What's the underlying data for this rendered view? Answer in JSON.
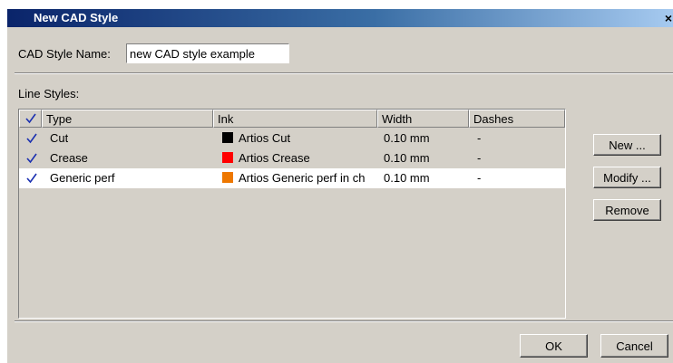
{
  "dialog": {
    "title": "New CAD Style",
    "close_glyph": "×"
  },
  "cad_style_name": {
    "label": "CAD Style Name:",
    "value": "new CAD style example"
  },
  "line_styles": {
    "label": "Line Styles:",
    "columns": [
      "Type",
      "Ink",
      "Width",
      "Dashes"
    ],
    "header_check_icon": "checkmark-icon",
    "rows": [
      {
        "checked": true,
        "type": "Cut",
        "ink": "Artios Cut",
        "ink_color": "#000000",
        "width": "0.10 mm",
        "dashes": "-"
      },
      {
        "checked": true,
        "type": "Crease",
        "ink": "Artios Crease",
        "ink_color": "#ff0000",
        "width": "0.10 mm",
        "dashes": "-"
      },
      {
        "checked": true,
        "type": "Generic perf",
        "ink": "Artios Generic perf in ch",
        "ink_color": "#ee7700",
        "width": "0.10 mm",
        "dashes": "-",
        "selected": true
      }
    ]
  },
  "side_buttons": {
    "new": "New ...",
    "modify": "Modify ...",
    "remove": "Remove"
  },
  "footer": {
    "ok": "OK",
    "cancel": "Cancel"
  },
  "colors": {
    "titlebar_start": "#0a246a",
    "titlebar_end": "#a6caf0",
    "dialog_bg": "#d4d0c8",
    "check": "#1a2fb0"
  }
}
